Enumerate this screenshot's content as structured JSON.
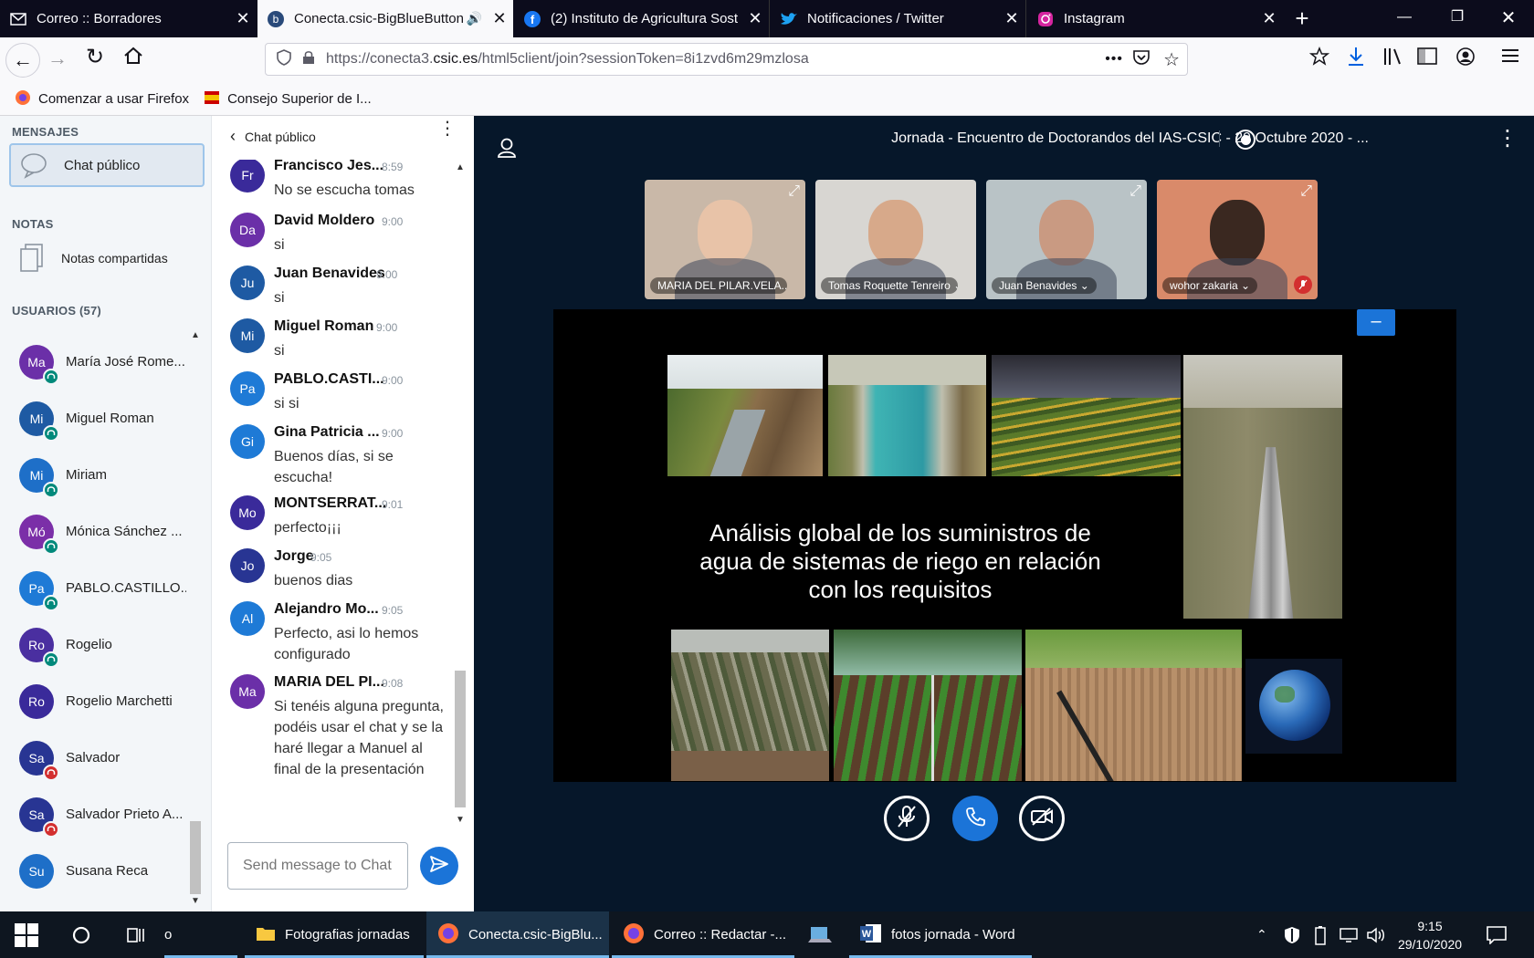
{
  "browser": {
    "tabs": [
      {
        "label": "Correo :: Borradores",
        "icon": "mail-icon"
      },
      {
        "label": "Conecta.csic-BigBlueButton",
        "icon": "bigbluebutton-icon",
        "active": true
      },
      {
        "label": "(2) Instituto de Agricultura Sost",
        "icon": "facebook-icon"
      },
      {
        "label": "Notificaciones / Twitter",
        "icon": "twitter-icon"
      },
      {
        "label": "Instagram",
        "icon": "instagram-icon"
      }
    ],
    "url_prefix": "https://conecta3.",
    "url_domain": "csic.es",
    "url_rest": "/html5client/join?sessionToken=8i1zvd6m29mzlosa",
    "bookmarks": [
      "Comenzar a usar Firefox",
      "Consejo Superior de I..."
    ],
    "more_icon": "•••"
  },
  "sidebar": {
    "messages_title": "MENSAJES",
    "public_chat": "Chat público",
    "notes_title": "NOTAS",
    "shared_notes": "Notas compartidas",
    "users_title": "USUARIOS (57)",
    "users": [
      {
        "initials": "Ma",
        "name": "María José Rome...",
        "color": "#6b2fa8",
        "status": "listen"
      },
      {
        "initials": "Mi",
        "name": "Miguel Roman",
        "color": "#1e5aa3",
        "status": "listen"
      },
      {
        "initials": "Mi",
        "name": "Miriam",
        "color": "#1e6fc8",
        "status": "listen"
      },
      {
        "initials": "Mó",
        "name": "Mónica Sánchez ...",
        "color": "#7b2fa8",
        "status": "listen"
      },
      {
        "initials": "Pa",
        "name": "PABLO.CASTILLO....",
        "color": "#1e7ad6",
        "status": "listen"
      },
      {
        "initials": "Ro",
        "name": "Rogelio",
        "color": "#4a2fa0",
        "status": "listen"
      },
      {
        "initials": "Ro",
        "name": "Rogelio Marchetti",
        "color": "#3a2a9a",
        "status": "none"
      },
      {
        "initials": "Sa",
        "name": "Salvador",
        "color": "#283593",
        "status": "muted"
      },
      {
        "initials": "Sa",
        "name": "Salvador Prieto A...",
        "color": "#283593",
        "status": "muted"
      },
      {
        "initials": "Su",
        "name": "Susana Reca",
        "color": "#1e6fc8",
        "status": "none"
      }
    ]
  },
  "chat": {
    "title": "Chat público",
    "placeholder": "Send message to Chat",
    "messages": [
      {
        "initials": "Fr",
        "name": "Francisco Jes...",
        "time": "8:59",
        "text": "No se escucha tomas",
        "color": "#3a2a9a"
      },
      {
        "initials": "Da",
        "name": "David Moldero",
        "time": "9:00",
        "text": "si",
        "color": "#6b2fa8"
      },
      {
        "initials": "Ju",
        "name": "Juan Benavides",
        "time": "9:00",
        "text": "si",
        "color": "#1e5aa3"
      },
      {
        "initials": "Mi",
        "name": "Miguel Roman",
        "time": "9:00",
        "text": "si",
        "color": "#1e5aa3"
      },
      {
        "initials": "Pa",
        "name": "PABLO.CASTI...",
        "time": "9:00",
        "text": "si si",
        "color": "#1e7ad6"
      },
      {
        "initials": "Gi",
        "name": "Gina Patricia ...",
        "time": "9:00",
        "text": "Buenos días, si se escucha!",
        "color": "#1e7ad6"
      },
      {
        "initials": "Mo",
        "name": "MONTSERRAT...",
        "time": "9:01",
        "text": "perfecto¡¡¡",
        "color": "#3a2a9a"
      },
      {
        "initials": "Jo",
        "name": "Jorge",
        "time": "9:05",
        "text": "buenos dias",
        "color": "#283593"
      },
      {
        "initials": "Al",
        "name": "Alejandro Mo...",
        "time": "9:05",
        "text": "Perfecto, asi lo hemos configurado",
        "color": "#1e7ad6"
      },
      {
        "initials": "Ma",
        "name": "MARIA DEL PI...",
        "time": "9:08",
        "text": "Si tenéis alguna pregunta, podéis usar el chat y se la haré llegar a Manuel al final de la presentación",
        "color": "#6b2fa8"
      }
    ]
  },
  "meeting": {
    "title": "Jornada - Encuentro de Doctorandos del IAS-CSIC - 29 Octubre 2020 - ...",
    "webcams": [
      {
        "name": "MARIA DEL PILAR.VELA...",
        "bg": "#c9b8a8",
        "face": "#e8c3a8"
      },
      {
        "name": "Tomas Roquette Tenreiro",
        "bg": "#d8d6d2",
        "face": "#d7a98a"
      },
      {
        "name": "Juan Benavides",
        "bg": "#b9c3c6",
        "face": "#c99a82"
      },
      {
        "name": "wohor zakaria",
        "bg": "#d98a6a",
        "face": "#3a2820"
      }
    ],
    "slide_text": "Análisis global de los suministros de agua de sistemas de riego en relación con los requisitos",
    "minimize_label": "–"
  },
  "taskbar": {
    "apps": [
      "Fotografias jornadas",
      "Conecta.csic-BigBlu...",
      "Correo :: Redactar -...",
      "fotos jornada - Word"
    ],
    "partial_label": "o",
    "time": "9:15",
    "date": "29/10/2020"
  },
  "colors": {
    "accent": "#1b74d8",
    "bbb_dark": "#06172a",
    "listen": "#00897b",
    "muted": "#d32f2f"
  }
}
